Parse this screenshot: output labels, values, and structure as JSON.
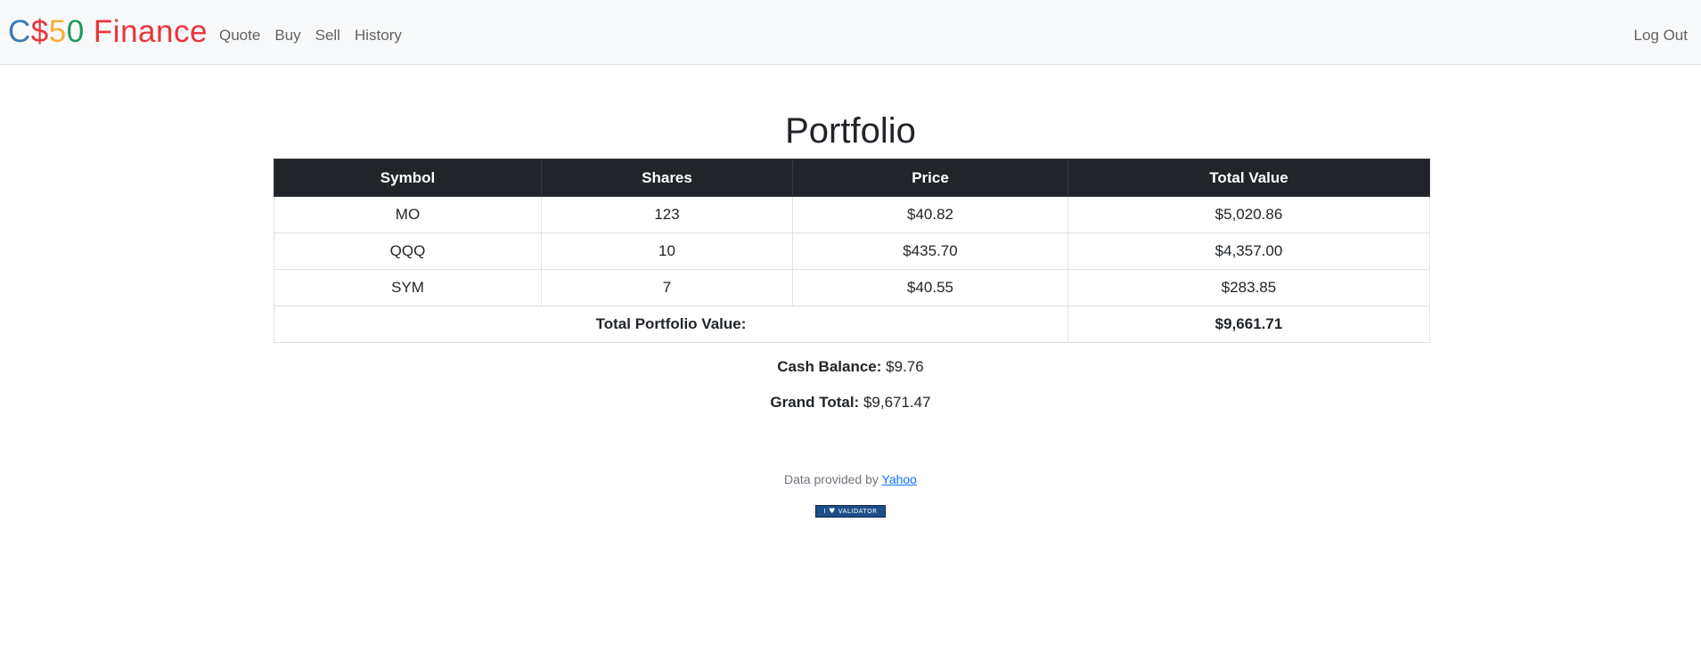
{
  "brand": {
    "parts": [
      {
        "text": "C",
        "color": "#3d7ab5"
      },
      {
        "text": "$",
        "color": "#e8363c"
      },
      {
        "text": "5",
        "color": "#f5b034"
      },
      {
        "text": "0",
        "color": "#1d9b5e"
      },
      {
        "text": " Finance",
        "color": "#e8363c"
      }
    ]
  },
  "nav": {
    "items": [
      {
        "label": "Quote"
      },
      {
        "label": "Buy"
      },
      {
        "label": "Sell"
      },
      {
        "label": "History"
      }
    ],
    "logout_label": "Log Out"
  },
  "main": {
    "title": "Portfolio",
    "table": {
      "headers": [
        "Symbol",
        "Shares",
        "Price",
        "Total Value"
      ],
      "rows": [
        {
          "symbol": "MO",
          "shares": "123",
          "price": "$40.82",
          "total": "$5,020.86"
        },
        {
          "symbol": "QQQ",
          "shares": "10",
          "price": "$435.70",
          "total": "$4,357.00"
        },
        {
          "symbol": "SYM",
          "shares": "7",
          "price": "$40.55",
          "total": "$283.85"
        }
      ],
      "footer_label": "Total Portfolio Value:",
      "footer_value": "$9,661.71"
    },
    "cash": {
      "label": "Cash Balance:",
      "value": "$9.76"
    },
    "grand_total": {
      "label": "Grand Total:",
      "value": "$9,671.47"
    }
  },
  "footer": {
    "text": "Data provided by",
    "link_label": "Yahoo",
    "badge": {
      "left": "I",
      "heart": "♥",
      "right": "VALIDATOR"
    }
  }
}
